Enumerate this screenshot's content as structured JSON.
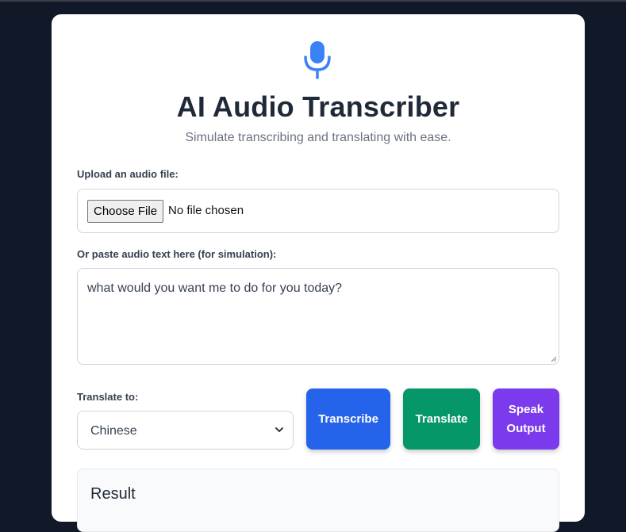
{
  "header": {
    "title": "AI Audio Transcriber",
    "subtitle": "Simulate transcribing and translating with ease.",
    "icon": "microphone-icon",
    "accent_color": "#3b82f6"
  },
  "upload": {
    "label": "Upload an audio file:",
    "button_label": "Choose File",
    "status_text": "No file chosen"
  },
  "paste": {
    "label": "Or paste audio text here (for simulation):",
    "value": "what would you want me to do for you today?"
  },
  "translate": {
    "label": "Translate to:",
    "selected": "Chinese"
  },
  "actions": {
    "transcribe_label": "Transcribe",
    "transcribe_color": "#2563eb",
    "translate_label": "Translate",
    "translate_color": "#059669",
    "speak_line1": "Speak",
    "speak_line2": "Output",
    "speak_color": "#7c3aed"
  },
  "result": {
    "title": "Result"
  }
}
